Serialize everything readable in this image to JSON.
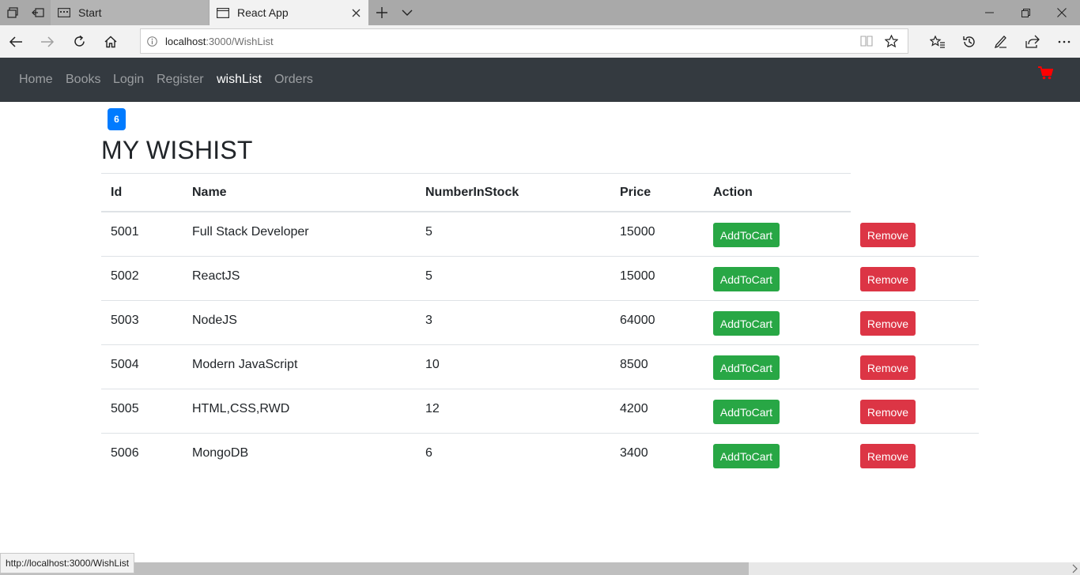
{
  "browser": {
    "tabs": [
      {
        "label": "Start",
        "active": false
      },
      {
        "label": "React App",
        "active": true
      }
    ],
    "url_host": "localhost",
    "url_rest": ":3000/WishList",
    "status_url": "http://localhost:3000/WishList"
  },
  "navbar": {
    "links": [
      "Home",
      "Books",
      "Login",
      "Register",
      "wishList",
      "Orders"
    ],
    "active": "wishList",
    "cart_color": "#ff0000"
  },
  "badge": "6",
  "title": "MY WISHIST",
  "table": {
    "headers": [
      "Id",
      "Name",
      "NumberInStock",
      "Price",
      "Action"
    ],
    "rows": [
      {
        "id": "5001",
        "name": "Full Stack Developer",
        "stock": "5",
        "price": "15000"
      },
      {
        "id": "5002",
        "name": "ReactJS",
        "stock": "5",
        "price": "15000"
      },
      {
        "id": "5003",
        "name": "NodeJS",
        "stock": "3",
        "price": "64000"
      },
      {
        "id": "5004",
        "name": "Modern JavaScript",
        "stock": "10",
        "price": "8500"
      },
      {
        "id": "5005",
        "name": "HTML,CSS,RWD",
        "stock": "12",
        "price": "4200"
      },
      {
        "id": "5006",
        "name": "MongoDB",
        "stock": "6",
        "price": "3400"
      }
    ],
    "add_label": "AddToCart",
    "remove_label": "Remove"
  },
  "colors": {
    "navbar": "#343a40",
    "badge": "#007bff",
    "success": "#28a745",
    "danger": "#dc3545"
  }
}
